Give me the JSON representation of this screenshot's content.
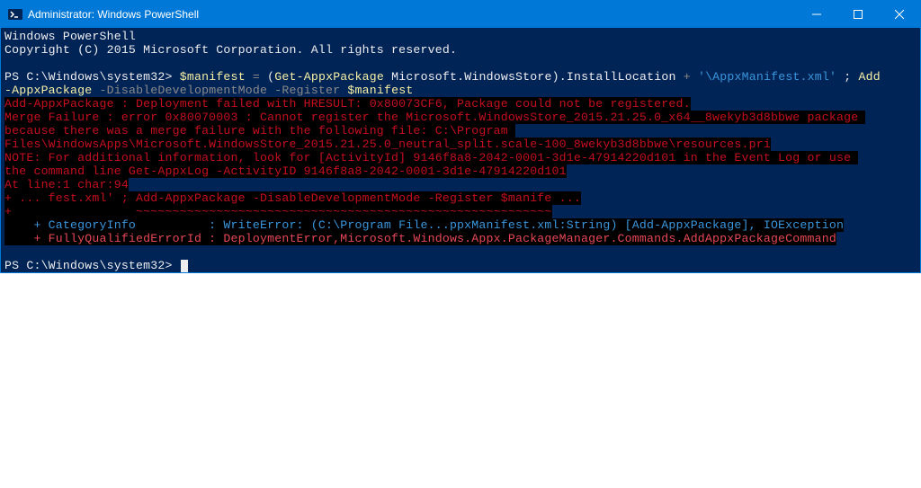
{
  "titlebar": {
    "title": "Administrator: Windows PowerShell"
  },
  "terminal": {
    "banner1": "Windows PowerShell",
    "banner2": "Copyright (C) 2015 Microsoft Corporation. All rights reserved.",
    "prompt1": "PS C:\\Windows\\system32>",
    "cmd": {
      "var": "$manifest",
      "eq": "=",
      "lparen": "(",
      "getappx": "Get-AppxPackage",
      "pkg": "Microsoft.WindowsStore",
      "rparen_prop": ").InstallLocation",
      "plus": "+",
      "str": "'\\AppxManifest.xml'",
      "sep": ";",
      "add1": "Add",
      "add2": "-AppxPackage",
      "flag1": "-DisableDevelopmentMode",
      "flag2": "-Register",
      "var2": "$manifest"
    },
    "err": {
      "l1": "Add-AppxPackage : Deployment failed with HRESULT: 0x80073CF6, Package could not be registered.",
      "l2": "Merge Failure : error 0x80070003 : Cannot register the Microsoft.WindowsStore_2015.21.25.0_x64__8wekyb3d8bbwe package ",
      "l3": "because there was a merge failure with the following file: C:\\Program ",
      "l4": "Files\\WindowsApps\\Microsoft.WindowsStore_2015.21.25.0_neutral_split.scale-100_8wekyb3d8bbwe\\resources.pri",
      "l5": "NOTE: For additional information, look for [ActivityId] 9146f8a8-2042-0001-3d1e-47914220d101 in the Event Log or use ",
      "l6": "the command line Get-AppxLog -ActivityID 9146f8a8-2042-0001-3d1e-47914220d101",
      "l7": "At line:1 char:94",
      "l8": "+ ... fest.xml' ; Add-AppxPackage -DisableDevelopmentMode -Register $manife ...",
      "l9": "+                 ~~~~~~~~~~~~~~~~~~~~~~~~~~~~~~~~~~~~~~~~~~~~~~~~~~~~~~~~~",
      "l10": "    + CategoryInfo          : WriteError: (C:\\Program File...ppxManifest.xml:String) [Add-AppxPackage], IOException",
      "l11": "    + FullyQualifiedErrorId : DeploymentError,Microsoft.Windows.Appx.PackageManager.Commands.AddAppxPackageCommand"
    },
    "prompt2": "PS C:\\Windows\\system32>"
  }
}
